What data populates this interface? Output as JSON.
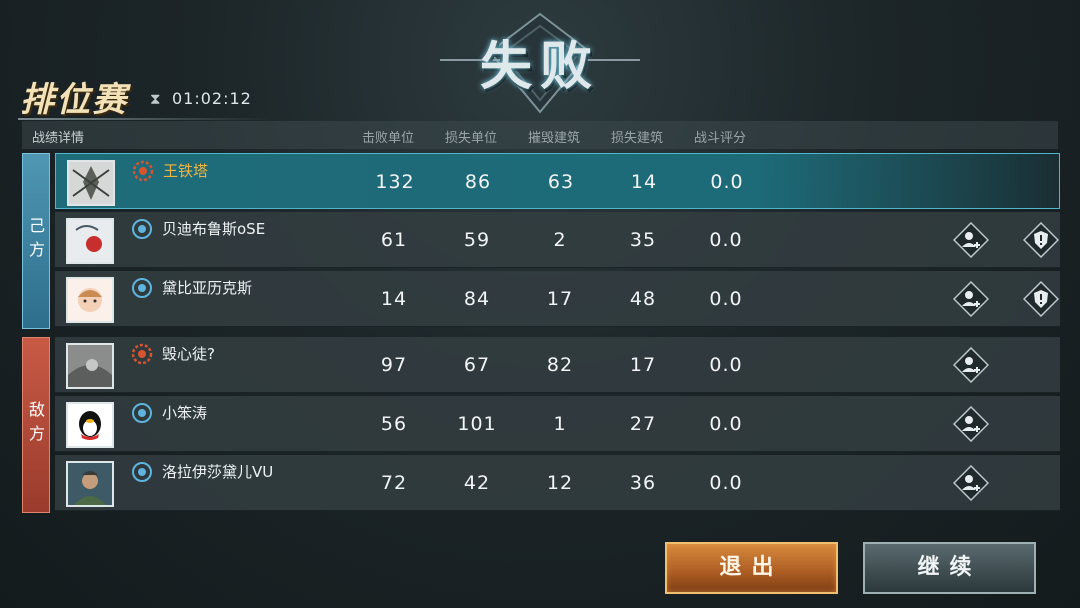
{
  "result_title": "失败",
  "mode_title": "排位赛",
  "timer": "01:02:12",
  "header": {
    "label": "战绩详情",
    "columns": [
      "击败单位",
      "损失单位",
      "摧毁建筑",
      "损失建筑",
      "战斗评分"
    ]
  },
  "teams": {
    "ally_label": "己\n方",
    "enemy_label": "敌\n方"
  },
  "players": [
    {
      "name": "王铁塔",
      "rank_icon": "red-gear-icon",
      "stats": [
        "132",
        "86",
        "63",
        "14",
        "0.0"
      ]
    },
    {
      "name": "贝迪布鲁斯oSE",
      "rank_icon": "blue-globe-icon",
      "stats": [
        "61",
        "59",
        "2",
        "35",
        "0.0"
      ]
    },
    {
      "name": "黛比亚历克斯",
      "rank_icon": "blue-globe-icon",
      "stats": [
        "14",
        "84",
        "17",
        "48",
        "0.0"
      ]
    },
    {
      "name": "毁心徒?",
      "rank_icon": "red-gear-icon",
      "stats": [
        "97",
        "67",
        "82",
        "17",
        "0.0"
      ]
    },
    {
      "name": "小笨涛",
      "rank_icon": "blue-globe-icon",
      "stats": [
        "56",
        "101",
        "1",
        "27",
        "0.0"
      ]
    },
    {
      "name": "洛拉伊莎黛儿VU",
      "rank_icon": "blue-globe-icon",
      "stats": [
        "72",
        "42",
        "12",
        "36",
        "0.0"
      ]
    }
  ],
  "buttons": {
    "exit": "退出",
    "continue": "继续"
  },
  "colors": {
    "ally": "#3f88a6",
    "enemy": "#b84a38",
    "highlight_name": "#f0b441",
    "exit_button": "#c07030"
  }
}
